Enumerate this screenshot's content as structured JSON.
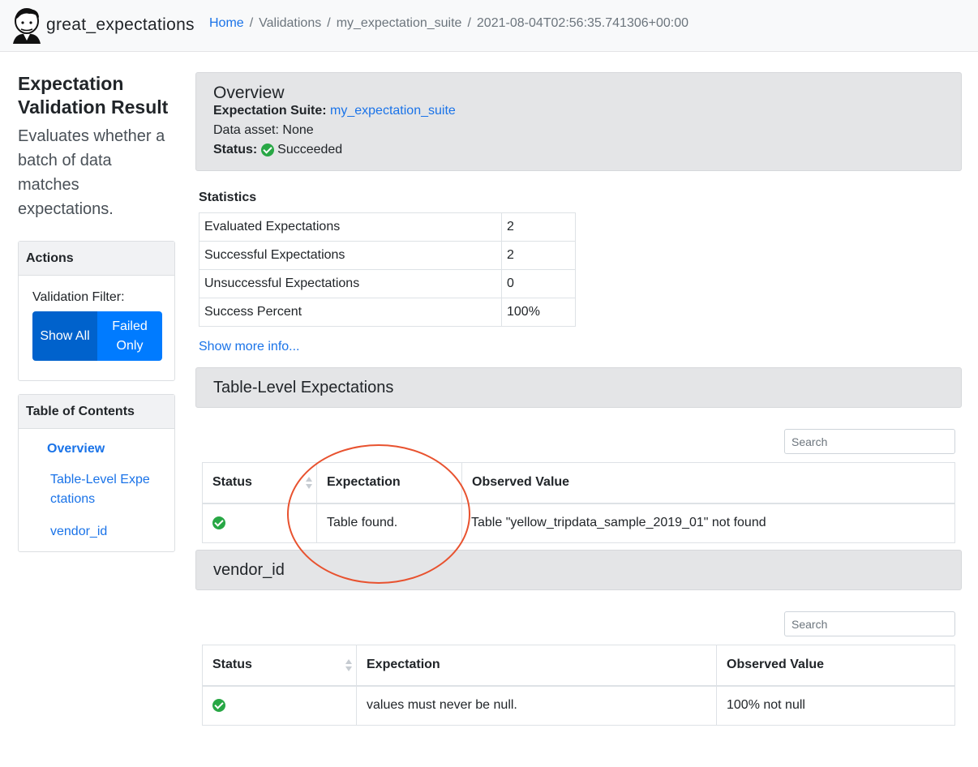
{
  "navbar": {
    "brand": "great_expectations",
    "breadcrumb": {
      "home": "Home",
      "sep1": "/",
      "validations": "Validations",
      "sep2": "/",
      "suite": "my_expectation_suite",
      "sep3": "/",
      "run": "2021-08-04T02:56:35.741306+00:00"
    }
  },
  "sidebar": {
    "title": "Expectation Validation Result",
    "description": "Evaluates whether a batch of data matches expectations.",
    "actions": {
      "header": "Actions",
      "filter_label": "Validation Filter:",
      "show_all": "Show All",
      "failed_only": "Failed Only"
    },
    "toc": {
      "header": "Table of Contents",
      "items": [
        "Overview",
        "Table-Level Expectations",
        "vendor_id"
      ]
    }
  },
  "overview": {
    "title": "Overview",
    "suite_label": "Expectation Suite:",
    "suite_value": "my_expectation_suite",
    "asset_label": "Data asset:",
    "asset_value": "None",
    "status_label": "Status:",
    "status_value": "Succeeded"
  },
  "statistics": {
    "title": "Statistics",
    "rows": [
      {
        "label": "Evaluated Expectations",
        "value": "2"
      },
      {
        "label": "Successful Expectations",
        "value": "2"
      },
      {
        "label": "Unsuccessful Expectations",
        "value": "0"
      },
      {
        "label": "Success Percent",
        "value": "100%"
      }
    ],
    "show_more": "Show more info..."
  },
  "sections": [
    {
      "title": "Table-Level Expectations",
      "search_placeholder": "Search",
      "headers": [
        "Status",
        "Expectation",
        "Observed Value"
      ],
      "rows": [
        {
          "expectation": "Table found.",
          "observed": "Table \"yellow_tripdata_sample_2019_01\" not found"
        }
      ]
    },
    {
      "title": "vendor_id",
      "search_placeholder": "Search",
      "headers": [
        "Status",
        "Expectation",
        "Observed Value"
      ],
      "rows": [
        {
          "expectation": "values must never be null.",
          "observed": "100% not null"
        }
      ]
    }
  ],
  "colors": {
    "link": "#1a73e8",
    "success": "#28a745",
    "primary": "#007bff",
    "annotation": "#e8522f"
  }
}
